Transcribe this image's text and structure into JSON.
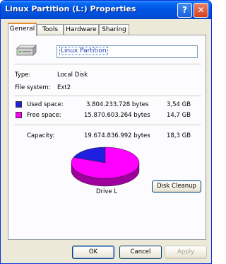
{
  "window": {
    "title": "Linux Partition (L:) Properties",
    "help_label": "?",
    "close_label": "✕"
  },
  "tabs": [
    {
      "label": "General",
      "active": true
    },
    {
      "label": "Tools",
      "active": false
    },
    {
      "label": "Hardware",
      "active": false
    },
    {
      "label": "Sharing",
      "active": false
    }
  ],
  "general": {
    "drive_icon": "hard-drive-icon",
    "volume_name": "Linux Partition",
    "type_label": "Type:",
    "type_value": "Local Disk",
    "fs_label": "File system:",
    "fs_value": "Ext2",
    "used": {
      "label": "Used space:",
      "bytes": "3.804.233.728 bytes",
      "size": "3,54 GB",
      "color": "#1f1fe0"
    },
    "free": {
      "label": "Free space:",
      "bytes": "15.870.603.264 bytes",
      "size": "14,7 GB",
      "color": "#ff00ff"
    },
    "capacity": {
      "label": "Capacity:",
      "bytes": "19.674.836.992 bytes",
      "size": "18,3 GB"
    },
    "drive_label": "Drive L",
    "cleanup_label": "Disk Cleanup"
  },
  "chart_data": {
    "type": "pie",
    "slices": [
      {
        "label": "Used space:",
        "value": 3804233728,
        "color": "#1f1fe0"
      },
      {
        "label": "Free space:",
        "value": 15870603264,
        "color": "#ff00ff"
      }
    ]
  },
  "footer": {
    "ok_label": "OK",
    "cancel_label": "Cancel",
    "apply_label": "Apply"
  }
}
